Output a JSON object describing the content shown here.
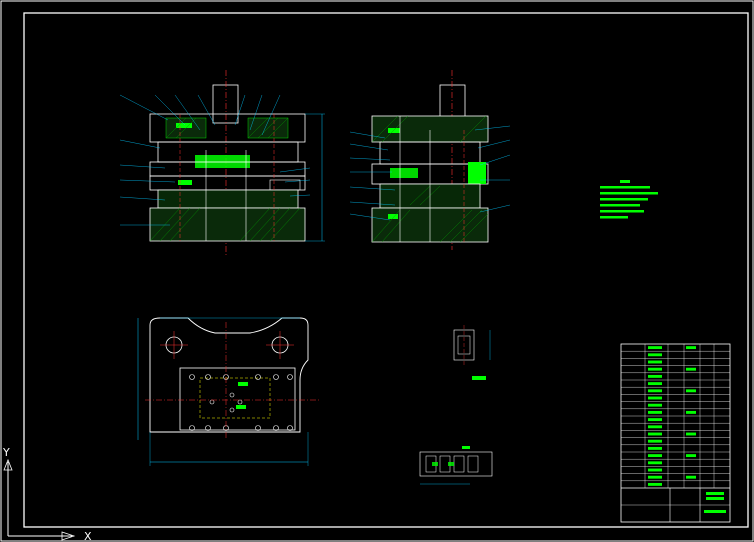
{
  "canvas": {
    "background": "#000000",
    "colors": {
      "outline": "#ffffff",
      "hatch": "#00ff00",
      "hatch_alt": "#00c000",
      "centerline": "#ff3030",
      "dimension": "#00c8ff",
      "leader": "#00c8ff",
      "hidden": "#ffff00",
      "part": "#e0e0e0",
      "die_body": "#ffffff",
      "fill_green": "#00ff00"
    }
  },
  "views": {
    "front_section": "front-section-view",
    "side_section": "side-section-view",
    "plan_view": "plan-view",
    "part_drawing": "part-drawing",
    "strip_layout": "strip-layout"
  },
  "technical_notes": {
    "color": "#00ff00",
    "lines": 6
  },
  "ucs": {
    "x_label": "X",
    "y_label": "Y"
  },
  "title_block": {
    "rows": 20
  }
}
